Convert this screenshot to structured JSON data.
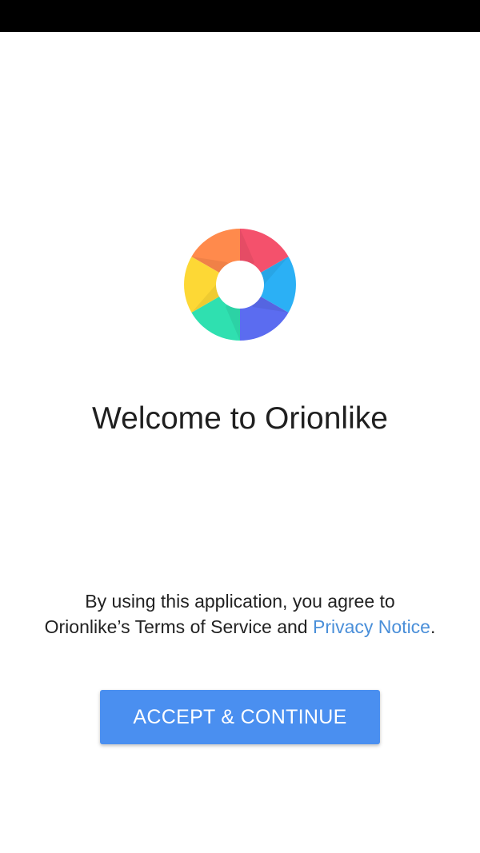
{
  "welcome": {
    "title": "Welcome to Orionlike"
  },
  "terms": {
    "prefix": "By using this application, you agree to Orionlike’s ",
    "terms_link": "Terms of Service",
    "middle": " and ",
    "privacy_link": "Privacy Notice",
    "suffix": "."
  },
  "accept_button": {
    "label": "ACCEPT & CONTINUE"
  },
  "colors": {
    "accent": "#4a8ff0",
    "link": "#4a8fd9",
    "logo_red": "#f4516c",
    "logo_blue": "#2bb0f5",
    "logo_indigo": "#5b6cf0",
    "logo_teal": "#2fe0b0",
    "logo_yellow": "#fdd835",
    "logo_orange": "#ff8a4c"
  },
  "icons": {
    "logo": "orionlike-logo-icon"
  }
}
